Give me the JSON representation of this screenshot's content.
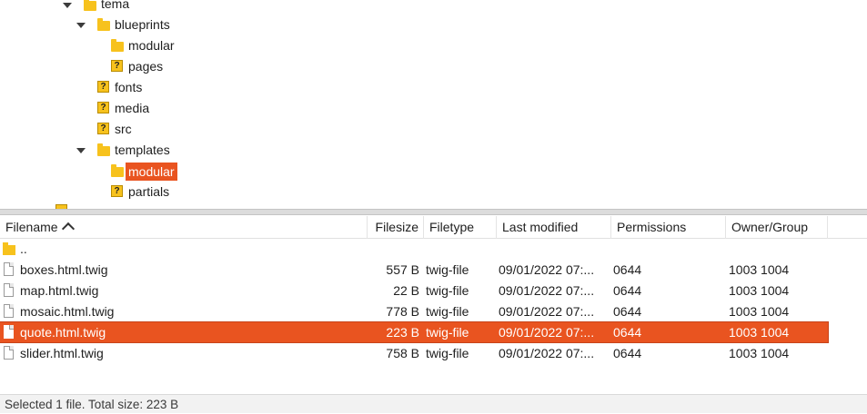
{
  "tree": {
    "items": [
      {
        "label": "tema",
        "icon": "folder-icon"
      },
      {
        "label": "blueprints",
        "icon": "folder-icon"
      },
      {
        "label": "modular",
        "icon": "folder-icon"
      },
      {
        "label": "pages",
        "icon": "unknown-folder-icon"
      },
      {
        "label": "fonts",
        "icon": "unknown-folder-icon"
      },
      {
        "label": "media",
        "icon": "unknown-folder-icon"
      },
      {
        "label": "src",
        "icon": "unknown-folder-icon"
      },
      {
        "label": "templates",
        "icon": "folder-icon"
      },
      {
        "label": "modular",
        "icon": "folder-icon",
        "selected": true
      },
      {
        "label": "partials",
        "icon": "unknown-folder-icon"
      }
    ],
    "unknown_glyph": "?"
  },
  "list": {
    "columns": [
      "Filename",
      "Filesize",
      "Filetype",
      "Last modified",
      "Permissions",
      "Owner/Group"
    ],
    "parent_dir": "..",
    "rows": [
      {
        "name": "boxes.html.twig",
        "size": "557 B",
        "type": "twig-file",
        "modified": "09/01/2022 07:...",
        "perms": "0644",
        "owner": "1003 1004"
      },
      {
        "name": "map.html.twig",
        "size": "22 B",
        "type": "twig-file",
        "modified": "09/01/2022 07:...",
        "perms": "0644",
        "owner": "1003 1004"
      },
      {
        "name": "mosaic.html.twig",
        "size": "778 B",
        "type": "twig-file",
        "modified": "09/01/2022 07:...",
        "perms": "0644",
        "owner": "1003 1004"
      },
      {
        "name": "quote.html.twig",
        "size": "223 B",
        "type": "twig-file",
        "modified": "09/01/2022 07:...",
        "perms": "0644",
        "owner": "1003 1004",
        "selected": true
      },
      {
        "name": "slider.html.twig",
        "size": "758 B",
        "type": "twig-file",
        "modified": "09/01/2022 07:...",
        "perms": "0644",
        "owner": "1003 1004"
      }
    ]
  },
  "status": {
    "text": "Selected 1 file. Total size: 223 B"
  },
  "colors": {
    "selection": "#e95420",
    "folder": "#f7c21d"
  }
}
